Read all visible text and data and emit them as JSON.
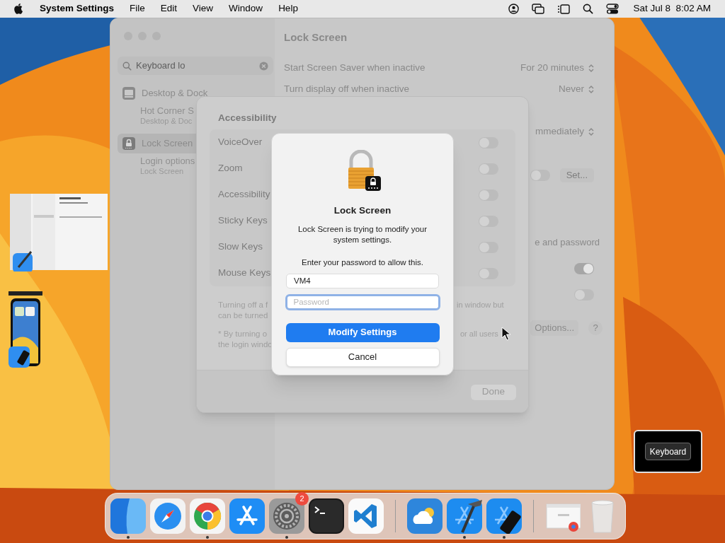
{
  "menu_bar": {
    "app": "System Settings",
    "menus": [
      "File",
      "Edit",
      "View",
      "Window",
      "Help"
    ],
    "clock": "Sat Jul 8  8:02 AM"
  },
  "settings_window": {
    "title": "Lock Screen",
    "search": {
      "value": "Keyboard lo"
    },
    "sidebar": [
      {
        "kind": "dock",
        "label": "Desktop & Dock",
        "selected": false,
        "children": [
          {
            "label": "Hot Corner S",
            "detail": "Desktop & Doc"
          }
        ]
      },
      {
        "kind": "lock",
        "label": "Lock Screen",
        "selected": true,
        "children": [
          {
            "label": "Login options",
            "detail": "Lock Screen"
          }
        ]
      }
    ],
    "rows": [
      {
        "kind": "popup",
        "label": "Start Screen Saver when inactive",
        "value": "For 20 minutes"
      },
      {
        "kind": "popup",
        "label": "Turn display off when inactive",
        "value": "Never"
      },
      {
        "kind": "popup",
        "value": "mmediately"
      },
      {
        "kind": "toggle_button",
        "on": false,
        "button": "Set..."
      },
      {
        "kind": "text",
        "label": "e and password"
      },
      {
        "kind": "toggle",
        "on": true
      },
      {
        "kind": "toggle",
        "on": false
      },
      {
        "kind": "button_help",
        "button": "Options...",
        "help": "?"
      }
    ]
  },
  "sheet": {
    "title": "Accessibility",
    "rows": [
      {
        "label": "VoiceOver",
        "on": false
      },
      {
        "label": "Zoom",
        "on": false
      },
      {
        "label": "Accessibility",
        "on": false
      },
      {
        "label": "Sticky Keys",
        "on": false
      },
      {
        "label": "Slow Keys",
        "on": false
      },
      {
        "label": "Mouse Keys",
        "on": false
      }
    ],
    "notes": [
      {
        "lines": [
          "Turning off a f",
          "can be turned"
        ],
        "tail": "in window but"
      },
      {
        "lines": [
          "* By turning o",
          "the login windo"
        ],
        "tail": "or all users"
      }
    ],
    "done": "Done"
  },
  "dialog": {
    "title": "Lock Screen",
    "message": "Lock Screen is trying to modify your system settings.",
    "prompt": "Enter your password to allow this.",
    "username": {
      "value": "VM4"
    },
    "password": {
      "placeholder": "Password"
    },
    "buttons": [
      {
        "kind": "default",
        "label": "Modify Settings"
      },
      {
        "kind": "normal",
        "label": "Cancel"
      }
    ]
  },
  "dock": [
    {
      "kind": "finder",
      "running": true
    },
    {
      "kind": "safari",
      "running": false
    },
    {
      "kind": "chrome",
      "running": true
    },
    {
      "kind": "appstore",
      "running": false
    },
    {
      "kind": "settings",
      "running": true,
      "badge": "2"
    },
    {
      "kind": "terminal",
      "running": false
    },
    {
      "kind": "vscode",
      "running": false
    },
    {
      "kind": "separator"
    },
    {
      "kind": "weather",
      "running": false
    },
    {
      "kind": "xcode",
      "running": true
    },
    {
      "kind": "simulator",
      "running": true
    },
    {
      "kind": "separator"
    },
    {
      "kind": "window",
      "running": false
    },
    {
      "kind": "trash",
      "running": false
    }
  ],
  "keyboard_hud": {
    "label": "Keyboard"
  }
}
